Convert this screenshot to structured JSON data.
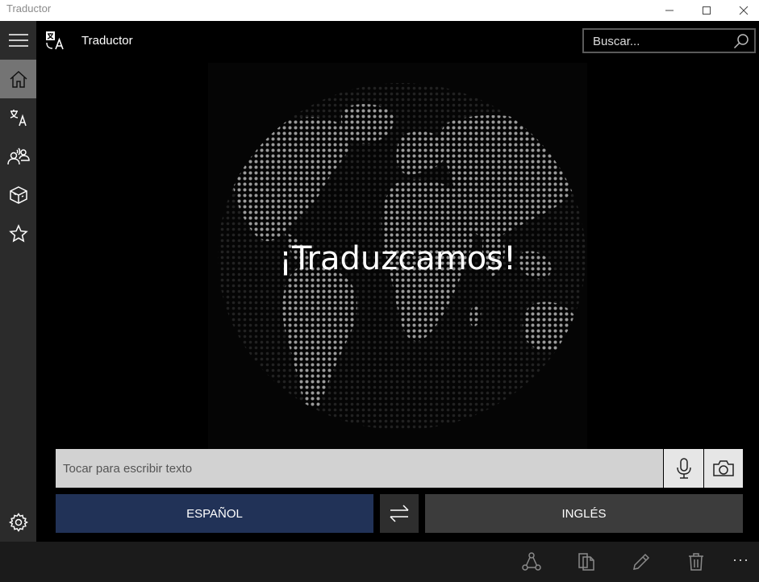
{
  "window": {
    "title": "Traductor"
  },
  "header": {
    "app_title": "Traductor",
    "search_placeholder": "Buscar..."
  },
  "sidebar": {
    "items": [
      {
        "icon": "hamburger-menu-icon"
      },
      {
        "icon": "home-icon",
        "active": true
      },
      {
        "icon": "translate-icon"
      },
      {
        "icon": "conversation-icon"
      },
      {
        "icon": "phrasebook-icon"
      },
      {
        "icon": "star-icon"
      }
    ],
    "bottom_icon": "settings-icon"
  },
  "main": {
    "headline": "¡Traduzcamos!",
    "input_placeholder": "Tocar para escribir texto",
    "source_language": "ESPAÑOL",
    "target_language": "INGLÉS"
  },
  "bottom_bar": {
    "icons": [
      "share-icon",
      "copy-icon",
      "edit-icon",
      "delete-icon"
    ],
    "more_label": "···"
  },
  "colors": {
    "source_language_bg": "#213257",
    "target_language_bg": "#3c3c3c",
    "sidebar_bg": "#2b2b2b",
    "active_sidebar_bg": "#747474"
  }
}
